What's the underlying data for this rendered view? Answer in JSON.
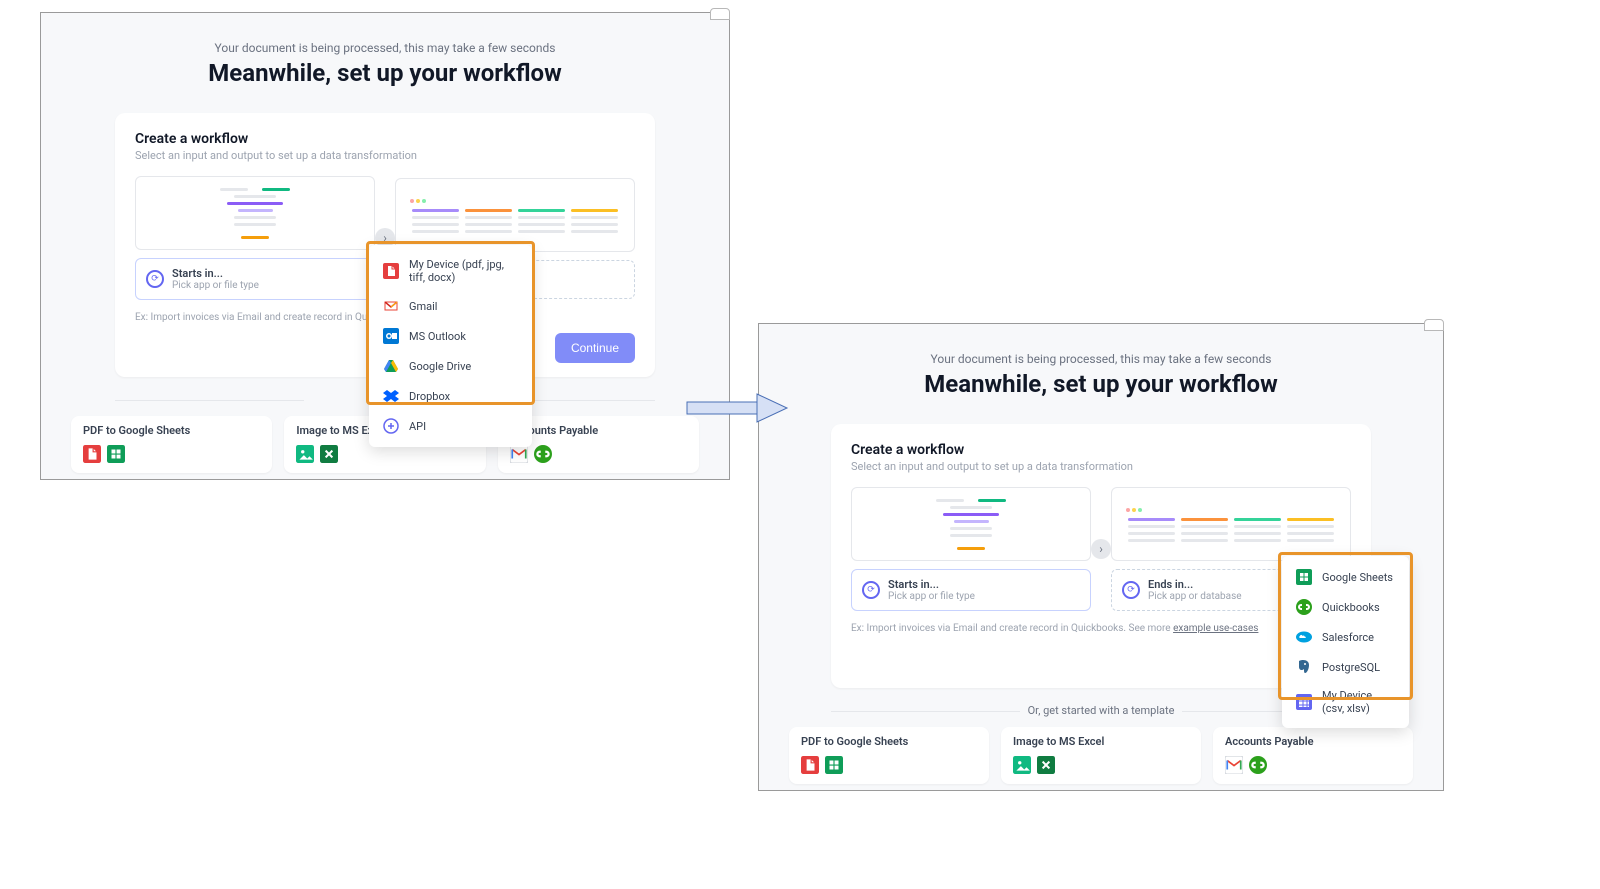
{
  "processing_text": "Your document is being processed, this may take a few seconds",
  "headline": "Meanwhile, set up your workflow",
  "card": {
    "title": "Create a workflow",
    "subtitle": "Select an input and output to set up a data transformation"
  },
  "starts_in": {
    "title": "Starts in...",
    "sub": "Pick app or file type"
  },
  "ends_in": {
    "title": "Ends in...",
    "sub": "Pick app or database"
  },
  "example_prefix": "Ex: Import invoices via Email and create record in Quickbooks. ",
  "example_see": "See more ",
  "example_link": "example use-cases",
  "continue_label": "Continue",
  "template_divider": "Or, get started with a template",
  "template_divider_left_truncated": "Or, g",
  "templates": [
    {
      "title": "PDF to Google Sheets",
      "icons": [
        "pdf",
        "sheets"
      ]
    },
    {
      "title": "Image to MS Excel",
      "icons": [
        "image",
        "excel"
      ]
    },
    {
      "title": "Accounts Payable",
      "icons": [
        "gmail-m",
        "quickbooks"
      ]
    }
  ],
  "dropdown_input": [
    {
      "label": "My Device (pdf, jpg, tiff, docx)",
      "icon": "pdf"
    },
    {
      "label": "Gmail",
      "icon": "gmail"
    },
    {
      "label": "MS Outlook",
      "icon": "outlook"
    },
    {
      "label": "Google Drive",
      "icon": "drive"
    },
    {
      "label": "Dropbox",
      "icon": "dropbox"
    },
    {
      "label": "API",
      "icon": "api"
    }
  ],
  "dropdown_output": [
    {
      "label": "Google Sheets",
      "icon": "sheets"
    },
    {
      "label": "Quickbooks",
      "icon": "quickbooks"
    },
    {
      "label": "Salesforce",
      "icon": "salesforce"
    },
    {
      "label": "PostgreSQL",
      "icon": "postgres"
    },
    {
      "label": "My Device (csv, xlsv)",
      "icon": "csv"
    }
  ]
}
